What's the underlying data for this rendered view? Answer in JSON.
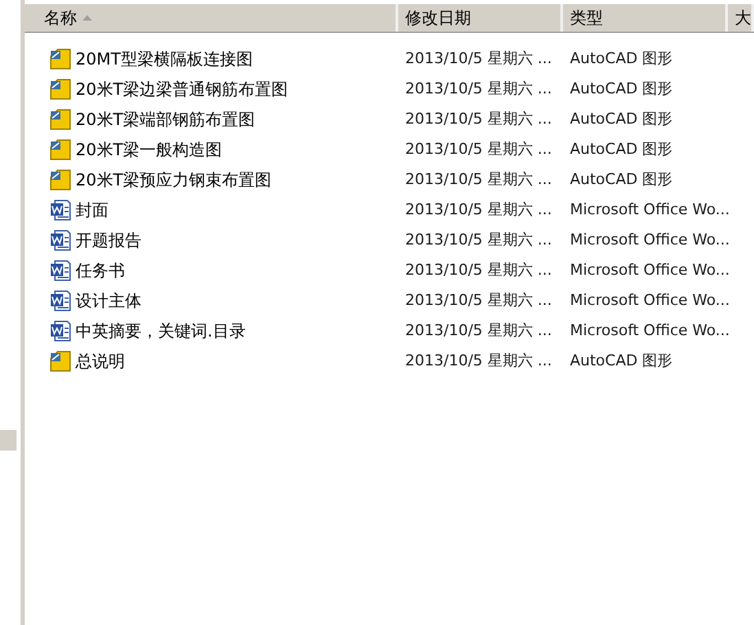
{
  "columns": [
    {
      "label": "名称",
      "sorted": true
    },
    {
      "label": "修改日期",
      "sorted": false
    },
    {
      "label": "类型",
      "sorted": false
    },
    {
      "label": "大",
      "sorted": false
    }
  ],
  "files": [
    {
      "kind": "cad",
      "name": "20MT型梁横隔板连接图",
      "modified": "2013/10/5 星期六 ...",
      "type": "AutoCAD 图形"
    },
    {
      "kind": "cad",
      "name": "20米T梁边梁普通钢筋布置图",
      "modified": "2013/10/5 星期六 ...",
      "type": "AutoCAD 图形"
    },
    {
      "kind": "cad",
      "name": "20米T梁端部钢筋布置图",
      "modified": "2013/10/5 星期六 ...",
      "type": "AutoCAD 图形"
    },
    {
      "kind": "cad",
      "name": "20米T梁一般构造图",
      "modified": "2013/10/5 星期六 ...",
      "type": "AutoCAD 图形"
    },
    {
      "kind": "cad",
      "name": "20米T梁预应力钢束布置图",
      "modified": "2013/10/5 星期六 ...",
      "type": "AutoCAD 图形"
    },
    {
      "kind": "word",
      "name": "封面",
      "modified": "2013/10/5 星期六 ...",
      "type": "Microsoft Office Wo..."
    },
    {
      "kind": "word",
      "name": "开题报告",
      "modified": "2013/10/5 星期六 ...",
      "type": "Microsoft Office Wo..."
    },
    {
      "kind": "word",
      "name": "任务书",
      "modified": "2013/10/5 星期六 ...",
      "type": "Microsoft Office Wo..."
    },
    {
      "kind": "word",
      "name": "设计主体",
      "modified": "2013/10/5 星期六 ...",
      "type": "Microsoft Office Wo..."
    },
    {
      "kind": "word",
      "name": "中英摘要，关键词.目录",
      "modified": "2013/10/5 星期六 ...",
      "type": "Microsoft Office Wo..."
    },
    {
      "kind": "cad",
      "name": "总说明",
      "modified": "2013/10/5 星期六 ...",
      "type": "AutoCAD 图形"
    }
  ]
}
